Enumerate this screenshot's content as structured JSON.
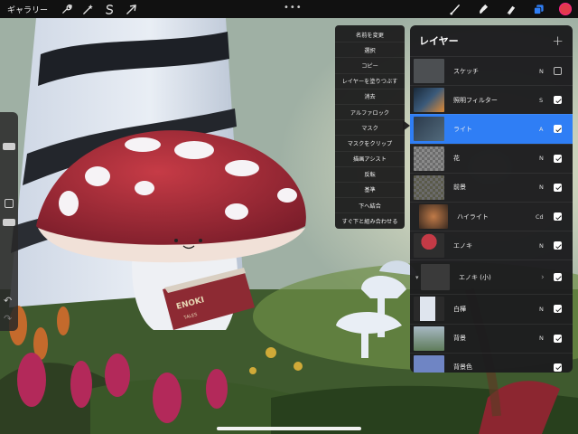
{
  "topbar": {
    "gallery_label": "ギャラリー",
    "more_label": "•••",
    "left_icons": [
      "wrench-icon",
      "magic-wand-icon",
      "selection-s-icon",
      "transform-arrow-icon"
    ],
    "right_icons": [
      "brush-icon",
      "smudge-icon",
      "eraser-icon",
      "layers-icon"
    ],
    "active_color": "#e23b4c",
    "accent_color": "#2f7ef5"
  },
  "layer_menu": {
    "items": [
      "名前を変更",
      "選択",
      "コピー",
      "レイヤーを塗りつぶす",
      "消去",
      "アルファロック",
      "マスク",
      "マスクをクリップ",
      "描画アシスト",
      "反転",
      "基準",
      "下へ結合",
      "すぐ下と組み合わせる"
    ]
  },
  "layers_panel": {
    "title": "レイヤー",
    "add_label": "+",
    "layers": [
      {
        "name": "スケッチ",
        "blend": "N",
        "visible": false
      },
      {
        "name": "照明フィルター",
        "blend": "S",
        "visible": true
      },
      {
        "name": "ライト",
        "blend": "A",
        "visible": true,
        "selected": true
      },
      {
        "name": "花",
        "blend": "N",
        "visible": true
      },
      {
        "name": "前景",
        "blend": "N",
        "visible": true
      },
      {
        "name": "ハイライト",
        "blend": "Cd",
        "visible": true
      },
      {
        "name": "エノキ",
        "blend": "N",
        "visible": true
      },
      {
        "name": "エノキ (小)",
        "blend": "",
        "visible": true,
        "group": true
      },
      {
        "name": "白樺",
        "blend": "N",
        "visible": true
      },
      {
        "name": "背景",
        "blend": "N",
        "visible": true
      },
      {
        "name": "背景色",
        "blend": "",
        "visible": true,
        "color": "#6f85c4"
      }
    ]
  },
  "artwork": {
    "book_title": "ENOKI",
    "book_subtitle": "TALES"
  }
}
